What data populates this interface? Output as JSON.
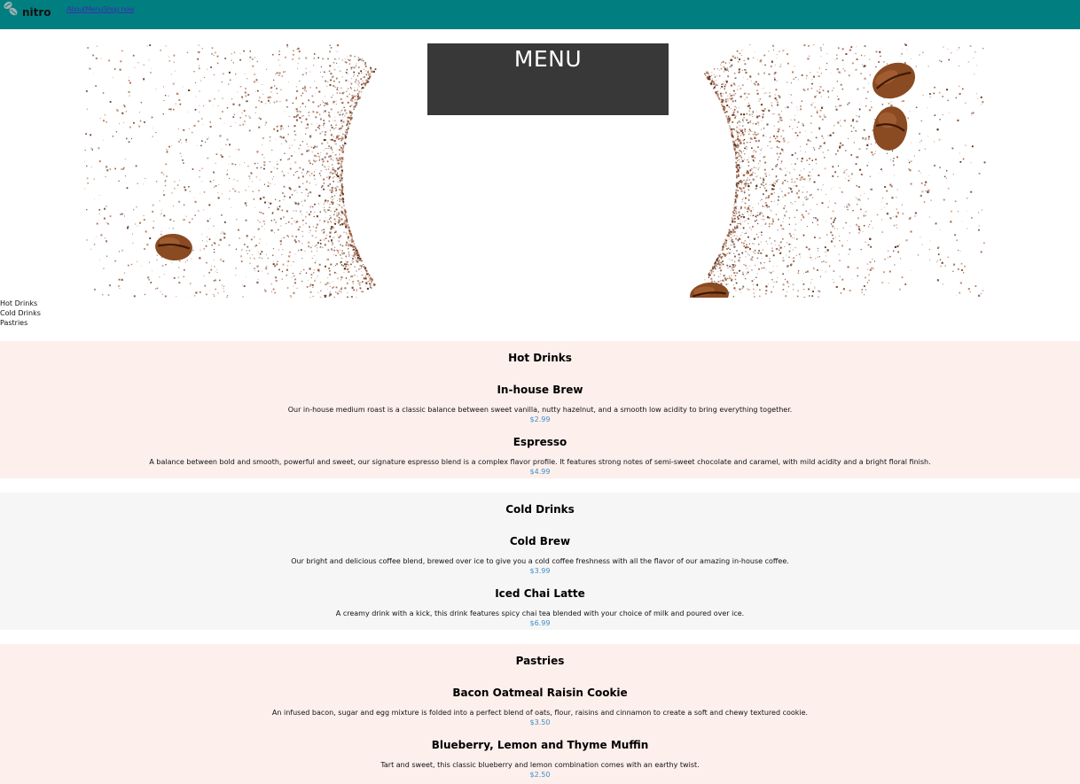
{
  "header": {
    "brand": "nitro",
    "nav": [
      "About",
      "Menu",
      "Shop now"
    ],
    "bar_color": "#017f80"
  },
  "hero": {
    "title": "MENU"
  },
  "category_links": [
    "Hot Drinks",
    "Cold Drinks",
    "Pastries"
  ],
  "sections": [
    {
      "title": "Hot Drinks",
      "items": [
        {
          "name": "In-house Brew",
          "description": "Our in-house medium roast is a classic balance between sweet vanilla, nutty hazelnut, and a smooth low acidity to bring everything together.",
          "price": "$2.99"
        },
        {
          "name": "Espresso",
          "description": "A balance between bold and smooth, powerful and sweet, our signature espresso blend is a complex flavor profile. It features strong notes of semi-sweet chocolate and caramel, with mild acidity and a bright floral finish.",
          "price": "$4.99"
        }
      ]
    },
    {
      "title": "Cold Drinks",
      "items": [
        {
          "name": "Cold Brew",
          "description": "Our bright and delicious coffee blend, brewed over ice to give you a cold coffee freshness with all the flavor of our amazing in-house coffee.",
          "price": "$3.99"
        },
        {
          "name": "Iced Chai Latte",
          "description": "A creamy drink with a kick, this drink features spicy chai tea blended with your choice of milk and poured over ice.",
          "price": "$6.99"
        }
      ]
    },
    {
      "title": "Pastries",
      "items": [
        {
          "name": "Bacon Oatmeal Raisin Cookie",
          "description": "An infused bacon, sugar and egg mixture is folded into a perfect blend of oats, flour, raisins and cinnamon to create a soft and chewy textured cookie.",
          "price": "$3.50"
        },
        {
          "name": "Blueberry, Lemon and Thyme Muffin",
          "description": "Tart and sweet, this classic blueberry and lemon combination comes with an earthy twist.",
          "price": "$2.50"
        }
      ]
    }
  ],
  "colors": {
    "price": "#3d8fc7",
    "section_pink": "#fdefec",
    "section_gray": "#f6f6f6",
    "menu_box": "#383838"
  }
}
